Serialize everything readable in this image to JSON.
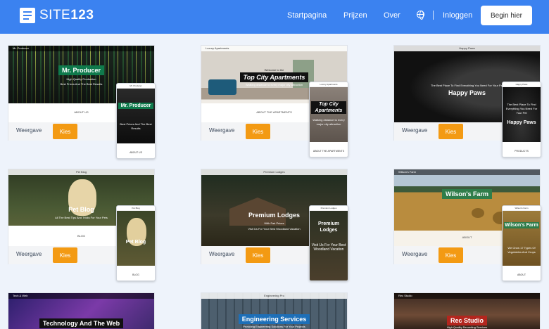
{
  "header": {
    "logo": {
      "prefix": "SITE",
      "number": "123"
    },
    "nav": [
      "Startpagina",
      "Prijzen",
      "Over"
    ],
    "login": "Inloggen",
    "cta": "Begin hier"
  },
  "card_actions": {
    "view": "Weergave",
    "pick": "Kies"
  },
  "templates": [
    {
      "brand": "Mr. Producer",
      "title": "Mr. Producer",
      "subtitle": "High Quality Production",
      "tagline": "Best Prices And The Best Results",
      "section": "ABOUT US",
      "mobile_title": "Mr. Producer",
      "mobile_sub": "Best Prices And The Best Results",
      "mobile_section": "ABOUT US"
    },
    {
      "brand": "Luxury Apartments",
      "title": "Top City Apartments",
      "subtitle": "Welcome to the",
      "tagline": "Walking distance to every major city attraction",
      "section": "ABOUT THE APARTMENTS",
      "mobile_title": "Top City Apartments",
      "mobile_sub": "Walking distance to every major city attraction",
      "mobile_section": "ABOUT THE APARTMENTS"
    },
    {
      "brand": "Happy Paws",
      "title": "Happy Paws",
      "subtitle": "",
      "tagline": "The Best Place To Find Everything You Need For Your Pet",
      "section": "",
      "mobile_title": "Happy Paws",
      "mobile_sub": "The Best Place To Find Everything You Need For Your Pet",
      "mobile_section": "PRODUCTS"
    },
    {
      "brand": "Pet Blog",
      "title": "Pet Blog",
      "subtitle": "",
      "tagline": "All The Best Tips And Tricks For Your Pets",
      "section": "BLOG",
      "mobile_title": "Pet Blog",
      "mobile_sub": "",
      "mobile_section": "BLOG"
    },
    {
      "brand": "Premium Lodges",
      "title": "Premium Lodges",
      "subtitle": "With Fair Prices",
      "tagline": "Visit Us For Your Best Woodland Vacation",
      "section": "",
      "mobile_title": "Premium Lodges",
      "mobile_sub": "Visit Us For Your Best Woodland Vacation",
      "mobile_section": ""
    },
    {
      "brand": "Wilson's Farm",
      "title": "Wilson's Farm",
      "subtitle": "",
      "tagline": "We Grow 17 Types Of Vegetables And Crops",
      "section": "ABOUT",
      "mobile_title": "Wilson's Farm",
      "mobile_sub": "We Grow 17 Types Of Vegetables And Crops",
      "mobile_section": "ABOUT"
    },
    {
      "brand": "Tech & Web",
      "title": "Technology And The Web",
      "subtitle": "",
      "tagline": "",
      "section": "",
      "mobile_title": "",
      "mobile_sub": "",
      "mobile_section": ""
    },
    {
      "brand": "Engineering Pro",
      "title": "Engineering Services",
      "subtitle": "Providing Engineering Solutions For Your Projects",
      "tagline": "",
      "section": "",
      "mobile_title": "",
      "mobile_sub": "",
      "mobile_section": ""
    },
    {
      "brand": "Rec Studio",
      "title": "Rec Studio",
      "subtitle": "High Quality Recording Services",
      "tagline": "",
      "section": "",
      "mobile_title": "",
      "mobile_sub": "",
      "mobile_section": ""
    }
  ],
  "colors": {
    "header": "#3b82f0",
    "pick_button": "#f39a13",
    "page_bg": "#eef3fb"
  }
}
